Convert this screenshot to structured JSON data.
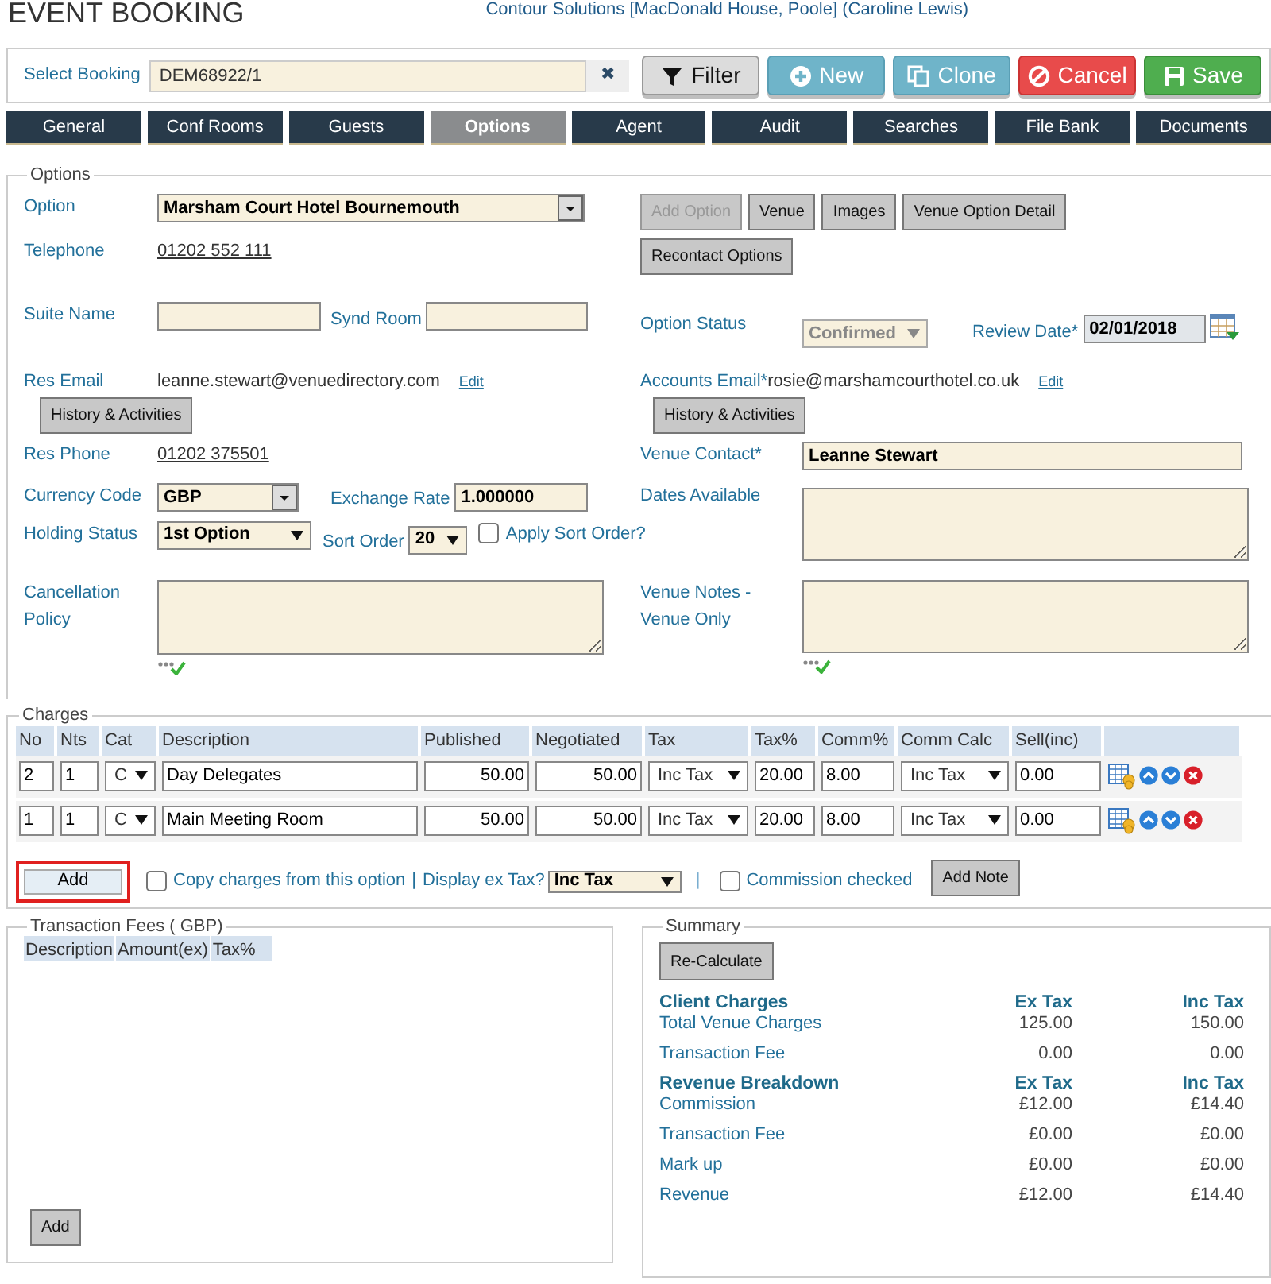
{
  "header": {
    "title": "EVENT BOOKING",
    "context": "Contour Solutions [MacDonald House, Poole] (Caroline Lewis)"
  },
  "booking_bar": {
    "label": "Select Booking",
    "value": "DEM68922/1",
    "clear": "✖",
    "actions": [
      {
        "kind": "filter",
        "label": "Filter"
      },
      {
        "kind": "new",
        "label": "New"
      },
      {
        "kind": "clone",
        "label": "Clone"
      },
      {
        "kind": "cancel",
        "label": "Cancel"
      },
      {
        "kind": "save",
        "label": "Save"
      }
    ]
  },
  "tabs": [
    {
      "label": "General",
      "selected": false
    },
    {
      "label": "Conf Rooms",
      "selected": false
    },
    {
      "label": "Guests",
      "selected": false
    },
    {
      "label": "Options",
      "selected": true
    },
    {
      "label": "Agent",
      "selected": false
    },
    {
      "label": "Audit",
      "selected": false
    },
    {
      "label": "Searches",
      "selected": false
    },
    {
      "label": "File Bank",
      "selected": false
    },
    {
      "label": "Documents",
      "selected": false
    }
  ],
  "options": {
    "legend": "Options",
    "option": {
      "label": "Option",
      "value": "Marsham Court Hotel Bournemouth"
    },
    "option_buttons": [
      {
        "label": "Add Option",
        "disabled": true
      },
      {
        "label": "Venue",
        "disabled": false
      },
      {
        "label": "Images",
        "disabled": false
      },
      {
        "label": "Venue Option Detail",
        "disabled": false
      }
    ],
    "recontact_button": "Recontact Options",
    "telephone": {
      "label": "Telephone",
      "value": "01202 552 111"
    },
    "suite_name": {
      "label": "Suite Name"
    },
    "synd_room": {
      "label": "Synd Room"
    },
    "option_status": {
      "label": "Option Status",
      "value": "Confirmed",
      "disabled": true
    },
    "review_date": {
      "label": "Review Date*",
      "value": "02/01/2018"
    },
    "res_email": {
      "label": "Res Email",
      "value": "leanne.stewart@venuedirectory.com",
      "edit": "Edit",
      "history_button": "History & Activities"
    },
    "accounts_email": {
      "label": "Accounts Email*",
      "value": "rosie@marshamcourthotel.co.uk",
      "edit": "Edit",
      "history_button": "History & Activities"
    },
    "res_phone": {
      "label": "Res Phone",
      "value": "01202 375501"
    },
    "venue_contact": {
      "label": "Venue Contact*",
      "value": "Leanne Stewart"
    },
    "currency_code": {
      "label": "Currency Code",
      "value": "GBP"
    },
    "exchange_rate": {
      "label": "Exchange Rate",
      "value": "1.000000"
    },
    "dates_available": {
      "label": "Dates Available"
    },
    "holding_status": {
      "label": "Holding Status",
      "value": "1st Option"
    },
    "sort_order": {
      "label": "Sort Order",
      "value": "20"
    },
    "apply_sort_order": {
      "label": "Apply Sort Order?",
      "checked": false
    },
    "cancellation_policy": {
      "label": "Cancellation Policy"
    },
    "venue_notes": {
      "label": "Venue Notes - Venue Only"
    }
  },
  "charges": {
    "legend": "Charges",
    "columns": [
      "No",
      "Nts",
      "Cat",
      "Description",
      "Published",
      "Negotiated",
      "Tax",
      "Tax%",
      "Comm%",
      "Comm Calc",
      "Sell(inc)"
    ],
    "rows": [
      {
        "no": "2",
        "nts": "1",
        "cat": "C",
        "description": "Day Delegates",
        "published": "50.00",
        "negotiated": "50.00",
        "tax": "Inc Tax",
        "tax_pct": "20.00",
        "comm_pct": "8.00",
        "comm_calc": "Inc Tax",
        "sell": "0.00"
      },
      {
        "no": "1",
        "nts": "1",
        "cat": "C",
        "description": "Main Meeting Room",
        "published": "50.00",
        "negotiated": "50.00",
        "tax": "Inc Tax",
        "tax_pct": "20.00",
        "comm_pct": "8.00",
        "comm_calc": "Inc Tax",
        "sell": "0.00"
      }
    ],
    "add_button": {
      "label": "Add",
      "highlighted": true
    },
    "copy_charges": {
      "label": "Copy charges from this option",
      "checked": false
    },
    "separators": [
      "|",
      "|"
    ],
    "display_ex_tax": {
      "label": "Display ex Tax?",
      "value": "Inc Tax"
    },
    "commission_checked": {
      "label": "Commission checked",
      "checked": false
    },
    "add_note_button": "Add Note"
  },
  "transaction_fees": {
    "legend": "Transaction Fees ( GBP)",
    "columns": [
      "Description",
      "Amount(ex)",
      "Tax%"
    ],
    "add_button": "Add"
  },
  "summary": {
    "legend": "Summary",
    "recalculate_button": "Re-Calculate",
    "groups": [
      {
        "heading": "Client Charges",
        "ex_heading": "Ex Tax",
        "inc_heading": "Inc Tax",
        "rows": [
          {
            "label": "Total Venue Charges",
            "ex": "125.00",
            "inc": "150.00"
          },
          {
            "label": "Transaction Fee",
            "ex": "0.00",
            "inc": "0.00"
          }
        ]
      },
      {
        "heading": "Revenue Breakdown",
        "ex_heading": "Ex Tax",
        "inc_heading": "Inc Tax",
        "rows": [
          {
            "label": "Commission",
            "ex": "£12.00",
            "inc": "£14.40"
          },
          {
            "label": "Transaction Fee",
            "ex": "£0.00",
            "inc": "£0.00"
          },
          {
            "label": "Mark up",
            "ex": "£0.00",
            "inc": "£0.00"
          },
          {
            "label": "Revenue",
            "ex": "£12.00",
            "inc": "£14.40"
          }
        ]
      }
    ]
  }
}
